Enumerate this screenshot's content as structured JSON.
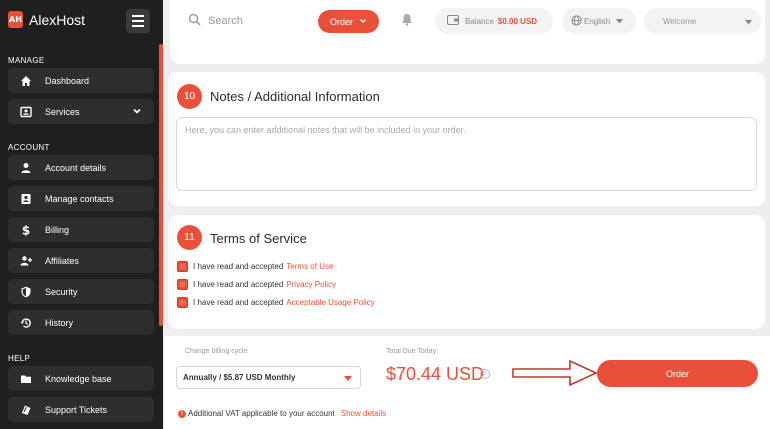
{
  "brand": {
    "logo_text": "AH",
    "name": "AlexHost"
  },
  "sidebar": {
    "sections": {
      "manage": "MANAGE",
      "account": "ACCOUNT",
      "help": "HELP"
    },
    "items": [
      {
        "label": "Dashboard",
        "icon": "home-icon"
      },
      {
        "label": "Services",
        "icon": "services-icon"
      },
      {
        "label": "Account details",
        "icon": "user-icon"
      },
      {
        "label": "Manage contacts",
        "icon": "contacts-icon"
      },
      {
        "label": "Billing",
        "icon": "dollar-icon"
      },
      {
        "label": "Affiliates",
        "icon": "affiliates-icon"
      },
      {
        "label": "Security",
        "icon": "shield-icon"
      },
      {
        "label": "History",
        "icon": "history-icon"
      },
      {
        "label": "Knowledge base",
        "icon": "folder-icon"
      },
      {
        "label": "Support Tickets",
        "icon": "ticket-icon"
      }
    ]
  },
  "topbar": {
    "search_placeholder": "Search",
    "order_label": "Order",
    "balance_label": "Balance",
    "balance_value": "$0.00 USD",
    "language": "English",
    "welcome": "Welcome"
  },
  "notes": {
    "step": "10",
    "title": "Notes / Additional Information",
    "placeholder": "Here, you can enter additional notes that will be included in your order."
  },
  "terms": {
    "step": "11",
    "title": "Terms of Service",
    "prefix": "I have read and accepted",
    "links": [
      "Terms of Use",
      "Privacy Policy",
      "Acceptable Usage Policy"
    ]
  },
  "footer": {
    "cycle_label": "Change billing cycle",
    "cycle_value": "Annually / $5.87 USD Monthly",
    "total_label": "Total Due Today:",
    "total_amount": "$70.44 USD",
    "help_glyph": "?",
    "order_label": "Order",
    "vat_glyph": "!",
    "vat_text": "Additional VAT applicable to your account",
    "vat_link": "Show details"
  },
  "colors": {
    "accent": "#e8503a",
    "sidebar": "#1f1f1f",
    "nav_item": "#2e2e2e"
  }
}
